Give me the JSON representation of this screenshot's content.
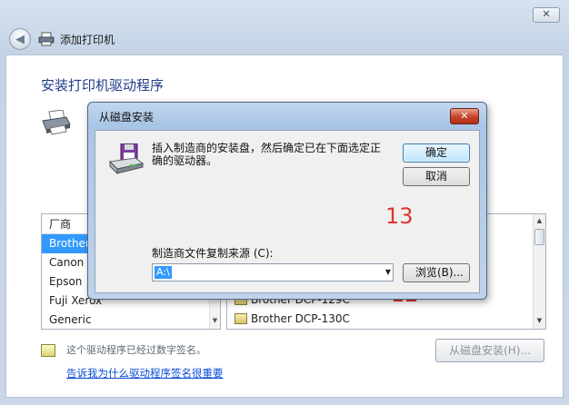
{
  "window": {
    "close_glyph": "✕",
    "back_glyph": "◀",
    "nav_title": "添加打印机",
    "heading": "安装打印机驱动程序"
  },
  "manufacturers": {
    "header": "厂商",
    "items": [
      "Brother",
      "Canon",
      "Epson",
      "Fuji Xerox",
      "Generic"
    ],
    "selected": "Brother",
    "scroll_glyph": "▼"
  },
  "printers": {
    "items": [
      "Brother DCP-129C",
      "Brother DCP-130C"
    ],
    "scroll_up": "▲",
    "scroll_down": "▼"
  },
  "signature": {
    "text": "这个驱动程序已经过数字签名。",
    "link": "告诉我为什么驱动程序签名很重要"
  },
  "buttons": {
    "have_disk": "从磁盘安装(H)..."
  },
  "annotations": {
    "step12": "12",
    "step13": "13"
  },
  "dialog": {
    "title": "从磁盘安装",
    "close_glyph": "✕",
    "message": "插入制造商的安装盘，然后确定已在下面选定正确的驱动器。",
    "ok": "确定",
    "cancel": "取消",
    "source_label": "制造商文件复制来源 (C):",
    "source_value": "A:\\",
    "dropdown_glyph": "▼",
    "browse": "浏览(B)..."
  },
  "colors": {
    "selection": "#3399ff",
    "annotation": "#e0342c",
    "heading": "#1f3c8c",
    "link": "#0a4bd6"
  }
}
